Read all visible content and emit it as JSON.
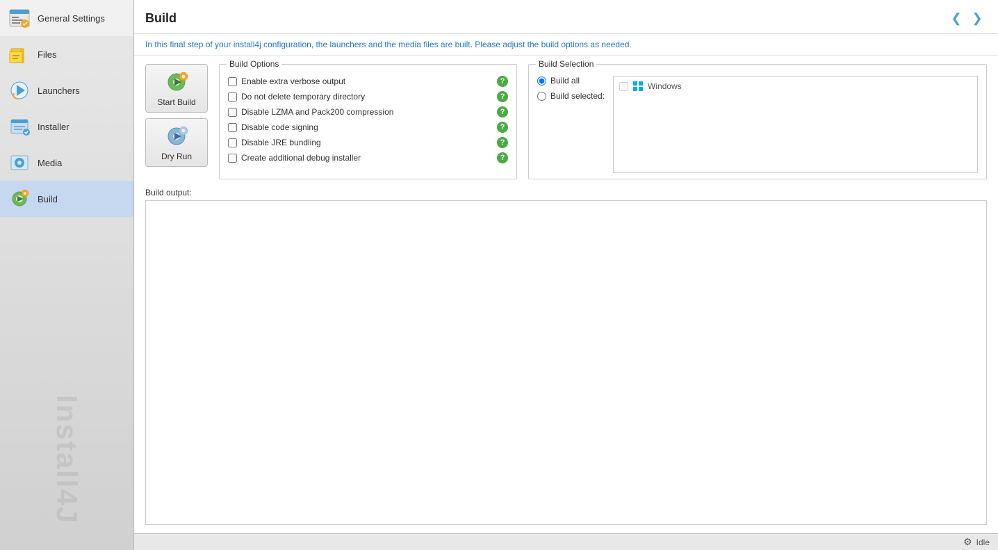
{
  "sidebar": {
    "items": [
      {
        "id": "general-settings",
        "label": "General Settings",
        "active": false
      },
      {
        "id": "files",
        "label": "Files",
        "active": false
      },
      {
        "id": "launchers",
        "label": "Launchers",
        "active": false
      },
      {
        "id": "installer",
        "label": "Installer",
        "active": false
      },
      {
        "id": "media",
        "label": "Media",
        "active": false
      },
      {
        "id": "build",
        "label": "Build",
        "active": true
      }
    ],
    "watermark": "Install4J"
  },
  "header": {
    "title": "Build",
    "subtitle": "In this final step of your install4j configuration, the launchers and the media files are built. Please adjust the build options as needed."
  },
  "buttons": {
    "start_build": "Start Build",
    "dry_run": "Dry Run"
  },
  "build_options": {
    "legend": "Build Options",
    "options": [
      {
        "id": "verbose",
        "label": "Enable extra verbose output",
        "checked": false
      },
      {
        "id": "no-delete-tmp",
        "label": "Do not delete temporary directory",
        "checked": false
      },
      {
        "id": "disable-lzma",
        "label": "Disable LZMA and Pack200 compression",
        "checked": false
      },
      {
        "id": "disable-signing",
        "label": "Disable code signing",
        "checked": false
      },
      {
        "id": "disable-jre",
        "label": "Disable JRE bundling",
        "checked": false
      },
      {
        "id": "debug-installer",
        "label": "Create additional debug installer",
        "checked": false
      }
    ]
  },
  "build_selection": {
    "legend": "Build Selection",
    "radio_options": [
      {
        "id": "build-all",
        "label": "Build all",
        "checked": true
      },
      {
        "id": "build-selected",
        "label": "Build selected:",
        "checked": false
      }
    ],
    "platforms": [
      {
        "label": "Windows"
      }
    ]
  },
  "build_output": {
    "label": "Build output:"
  },
  "status_bar": {
    "status": "Idle"
  },
  "nav": {
    "prev_title": "Previous",
    "next_title": "Next"
  }
}
